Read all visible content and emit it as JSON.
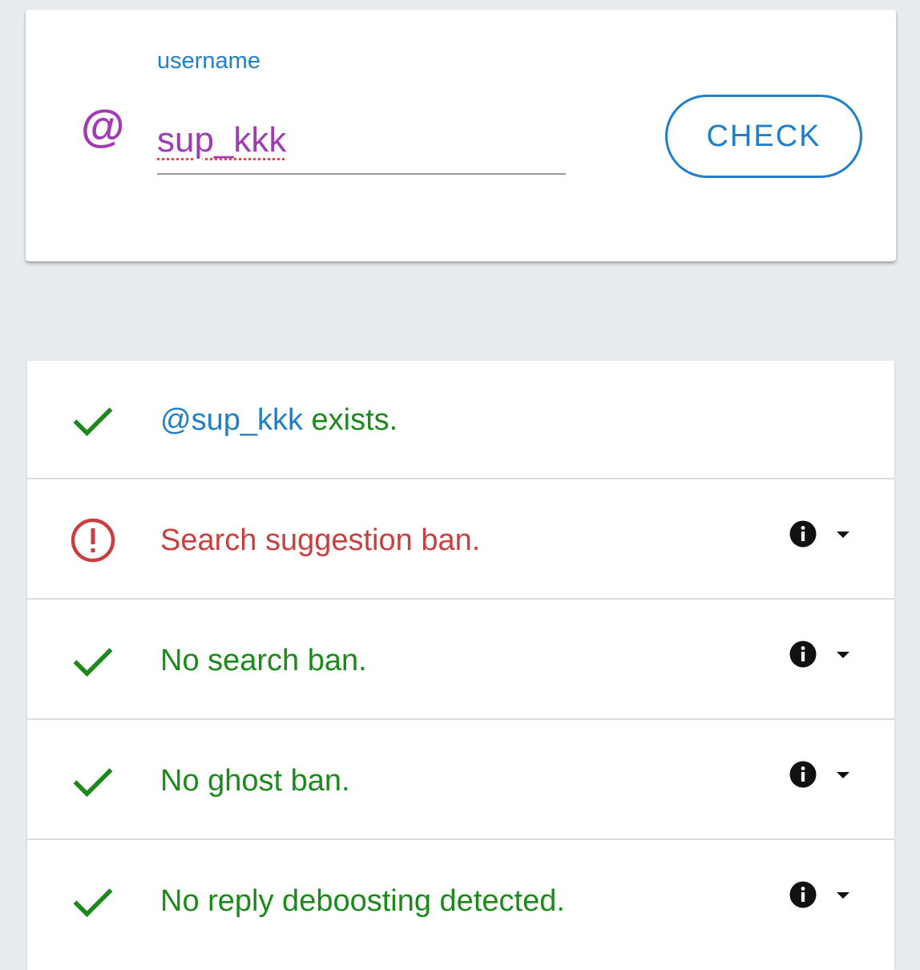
{
  "search": {
    "label": "username",
    "at_symbol": "@",
    "value": "sup_kkk",
    "check_label": "CHECK"
  },
  "results": [
    {
      "status": "ok",
      "user_mention": "@sup_kkk",
      "text": " exists."
    },
    {
      "status": "bad",
      "text": "Search suggestion ban."
    },
    {
      "status": "ok",
      "text": "No search ban."
    },
    {
      "status": "ok",
      "text": "No ghost ban."
    },
    {
      "status": "ok",
      "text": "No reply deboosting detected."
    }
  ],
  "colors": {
    "accent": "#1f7fc9",
    "username": "#a23ab5",
    "success": "#1b8a1b",
    "error": "#c94040",
    "background": "#e8ebee"
  }
}
